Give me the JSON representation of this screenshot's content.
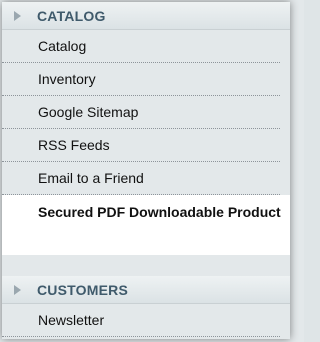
{
  "sections": [
    {
      "title": "CATALOG",
      "items": [
        {
          "label": "Catalog"
        },
        {
          "label": "Inventory"
        },
        {
          "label": "Google Sitemap"
        },
        {
          "label": "RSS Feeds"
        },
        {
          "label": "Email to a Friend"
        },
        {
          "label": "Secured PDF Downloadable Product",
          "active": true
        }
      ]
    },
    {
      "title": "CUSTOMERS",
      "items": [
        {
          "label": "Newsletter"
        }
      ]
    }
  ],
  "colors": {
    "header_text": "#3f5a6b",
    "arrow": "#9aa7af",
    "panel_bg": "#e3e8ea",
    "active_bg": "#ffffff"
  }
}
